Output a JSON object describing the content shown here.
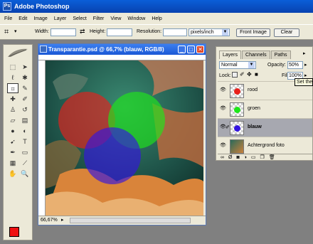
{
  "app": {
    "title": "Adobe Photoshop",
    "icon": "photoshop-icon"
  },
  "menu": [
    "File",
    "Edit",
    "Image",
    "Layer",
    "Select",
    "Filter",
    "View",
    "Window",
    "Help"
  ],
  "options": {
    "width_label": "Width:",
    "height_label": "Height:",
    "resolution_label": "Resolution:",
    "units_value": "pixels/inch",
    "front_image_label": "Front Image",
    "clear_label": "Clear",
    "width_value": "",
    "height_value": "",
    "resolution_value": ""
  },
  "document": {
    "title": "Transparantie.psd @ 66,7% (blauw, RGB/8)",
    "zoom": "66,67%",
    "circle_colors": {
      "red": "#e8201c",
      "green": "#1ee61a",
      "blue": "#3414e0"
    }
  },
  "colors": {
    "foreground": "#ee1111",
    "background": "#ffffff"
  },
  "layers_panel": {
    "tabs": [
      "Layers",
      "Channels",
      "Paths"
    ],
    "blend_mode": "Normal",
    "opacity_label": "Opacity:",
    "opacity_value": "50%",
    "lock_label": "Lock:",
    "fill_label": "Fill:",
    "fill_value": "100%",
    "tooltip": "Set the",
    "layers": [
      {
        "name": "rood",
        "color": "#e8201c",
        "selected": false
      },
      {
        "name": "groen",
        "color": "#1ee61a",
        "selected": false
      },
      {
        "name": "blauw",
        "color": "#3414e0",
        "selected": true
      },
      {
        "name": "Achtergrond foto",
        "color": "",
        "selected": false
      }
    ]
  }
}
